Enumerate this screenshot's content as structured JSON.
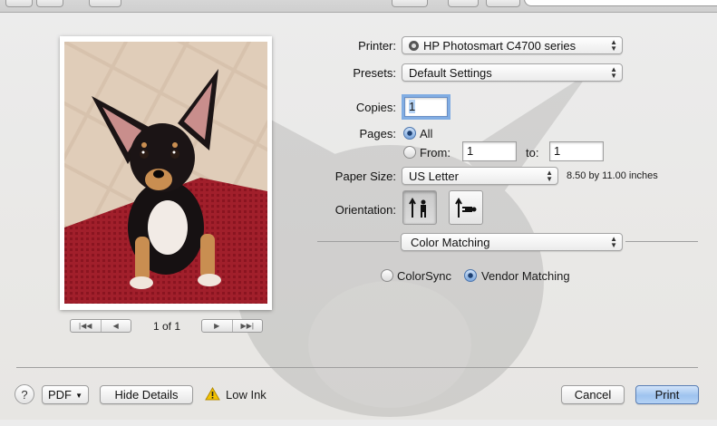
{
  "preview": {
    "page_indicator": "1 of 1"
  },
  "printer": {
    "label": "Printer:",
    "value": "HP Photosmart C4700 series"
  },
  "presets": {
    "label": "Presets:",
    "value": "Default Settings"
  },
  "copies": {
    "label": "Copies:",
    "value": "1"
  },
  "pages": {
    "label": "Pages:",
    "all_label": "All",
    "from_label": "From:",
    "from_value": "1",
    "to_label": "to:",
    "to_value": "1",
    "selected": "all"
  },
  "paper_size": {
    "label": "Paper Size:",
    "value": "US Letter",
    "dimensions": "8.50 by 11.00 inches"
  },
  "orientation": {
    "label": "Orientation:",
    "selected": "portrait"
  },
  "panel": {
    "value": "Color Matching"
  },
  "color_matching": {
    "colorsync_label": "ColorSync",
    "vendor_label": "Vendor Matching",
    "selected": "vendor"
  },
  "footer": {
    "help_label": "?",
    "pdf_label": "PDF",
    "hide_details_label": "Hide Details",
    "low_ink_label": "Low Ink",
    "cancel_label": "Cancel",
    "print_label": "Print"
  },
  "colors": {
    "accent": "#9ec3ef",
    "warning": "#f2c200"
  }
}
